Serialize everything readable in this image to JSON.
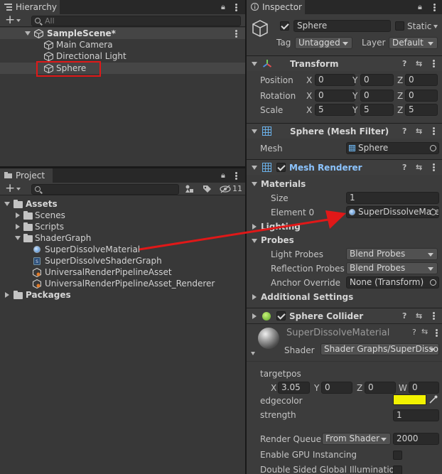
{
  "hierarchy": {
    "tab_label": "Hierarchy",
    "search_placeholder": "All",
    "scene": "SampleScene*",
    "items": [
      "Main Camera",
      "Directional Light",
      "Sphere"
    ]
  },
  "project": {
    "tab_label": "Project",
    "hidden_count": "11",
    "tree": {
      "assets": "Assets",
      "scenes": "Scenes",
      "scripts": "Scripts",
      "shadergraph": "ShaderGraph",
      "files": [
        "SuperDissolveMaterial",
        "SuperDissolveShaderGraph",
        "UniversalRenderPipelineAsset",
        "UniversalRenderPipelineAsset_Renderer"
      ],
      "packages": "Packages"
    }
  },
  "inspector": {
    "tab_label": "Inspector",
    "object_name": "Sphere",
    "static_label": "Static",
    "tag_label": "Tag",
    "tag_value": "Untagged",
    "layer_label": "Layer",
    "layer_value": "Default",
    "transform": {
      "title": "Transform",
      "position_label": "Position",
      "rotation_label": "Rotation",
      "scale_label": "Scale",
      "axes": [
        "X",
        "Y",
        "Z"
      ],
      "position": [
        "0",
        "0",
        "0"
      ],
      "rotation": [
        "0",
        "0",
        "0"
      ],
      "scale": [
        "5",
        "5",
        "5"
      ]
    },
    "mesh_filter": {
      "title": "Sphere (Mesh Filter)",
      "mesh_label": "Mesh",
      "mesh_value": "Sphere"
    },
    "mesh_renderer": {
      "title": "Mesh Renderer",
      "materials_label": "Materials",
      "size_label": "Size",
      "size_value": "1",
      "element0_label": "Element 0",
      "element0_value": "SuperDissolveMaterial",
      "lighting_label": "Lighting",
      "probes_label": "Probes",
      "light_probes_label": "Light Probes",
      "light_probes_value": "Blend Probes",
      "reflection_probes_label": "Reflection Probes",
      "reflection_probes_value": "Blend Probes",
      "anchor_override_label": "Anchor Override",
      "anchor_override_value": "None (Transform)",
      "additional_settings_label": "Additional Settings"
    },
    "sphere_collider": {
      "title": "Sphere Collider"
    },
    "material": {
      "name": "SuperDissolveMaterial",
      "shader_label": "Shader",
      "shader_value": "Shader Graphs/SuperDissolve",
      "targetpos_label": "targetpos",
      "targetpos": {
        "x": "3.05",
        "y": "0",
        "z": "0",
        "w": "0"
      },
      "axes4": [
        "X",
        "Y",
        "Z",
        "W"
      ],
      "edgecolor_label": "edgecolor",
      "edgecolor": "#f2f200",
      "strength_label": "strength",
      "strength_value": "1",
      "render_queue_label": "Render Queue",
      "render_queue_mode": "From Shader",
      "render_queue_value": "2000",
      "gpu_instancing_label": "Enable GPU Instancing",
      "double_sided_gi_label": "Double Sided Global Illumination"
    }
  },
  "colors": {
    "annotation": "#e01818",
    "selection": "#4d4d4d"
  }
}
